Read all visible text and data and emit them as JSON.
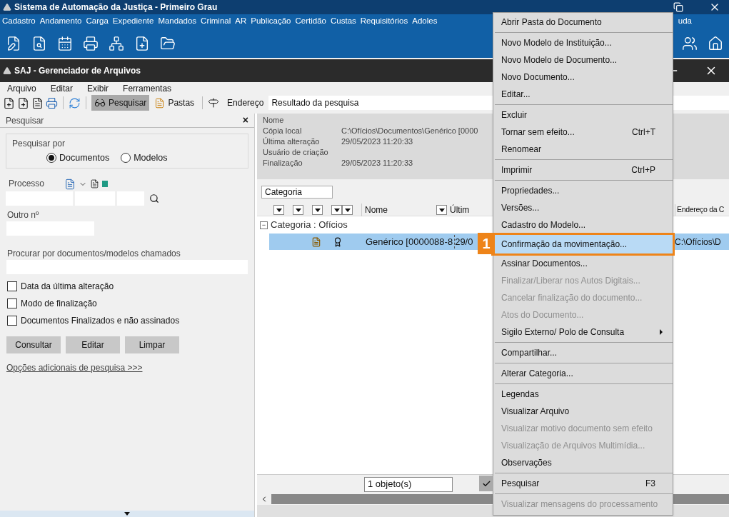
{
  "app": {
    "title": "Sistema de Automação da Justiça - Primeiro Grau",
    "menu": [
      "Cadastro",
      "Andamento",
      "Carga",
      "Expediente",
      "Mandados",
      "Criminal",
      "AR",
      "Publicação",
      "Certidão",
      "Custas",
      "Requisitórios",
      "Adoles"
    ],
    "menu_tail": "uda"
  },
  "window": {
    "title": "SAJ - Gerenciador de Arquivos",
    "menu": [
      "Arquivo",
      "Editar",
      "Exibir",
      "Ferramentas"
    ],
    "toolbar": [
      {
        "label": "Pesquisar",
        "selected": true
      },
      {
        "label": "Pastas",
        "selected": false
      }
    ],
    "address_label": "Endereço",
    "address_value": "Resultado da pesquisa"
  },
  "search_panel": {
    "title": "Pesquisar",
    "close": "×",
    "search_by_label": "Pesquisar por",
    "options": [
      {
        "label": "Documentos",
        "selected": true
      },
      {
        "label": "Modelos",
        "selected": false
      }
    ],
    "processo_label": "Processo",
    "outro_label": "Outro nº",
    "named_label": "Procurar por documentos/modelos chamados",
    "checkboxes": [
      {
        "label": "Data da última alteração",
        "checked": false
      },
      {
        "label": "Modo de finalização",
        "checked": false
      },
      {
        "label": "Documentos Finalizados e não assinados",
        "checked": false
      }
    ],
    "buttons": [
      "Consultar",
      "Editar",
      "Limpar"
    ],
    "link": "Opções adicionais de pesquisa >>>"
  },
  "details": [
    {
      "label": "Nome"
    },
    {
      "label": "Cópia local",
      "value": "C:\\Ofícios\\Documentos\\Genérico [0000"
    },
    {
      "label": "Última alteração",
      "value": "29/05/2023 11:20:33"
    },
    {
      "label": "Usuário de criação"
    },
    {
      "label": "Finalização",
      "value": "29/05/2023 11:20:33"
    }
  ],
  "grid": {
    "group_by": "Categoria",
    "collapse": "−",
    "columns": [
      "Nome",
      "Últim",
      "Endereço da C"
    ],
    "group": "Categoria : Ofícios",
    "rows": [
      {
        "name": "Genérico [0000088-8",
        "date": "29/0",
        "path": "C:\\Ofícios\\D",
        "selected": true
      }
    ],
    "footer": "1 objeto(s)"
  },
  "context_menu": [
    {
      "kind": "item",
      "label": "Abrir Pasta do Documento",
      "disabled": false,
      "selected": false
    },
    {
      "kind": "separator"
    },
    {
      "kind": "item",
      "label": "Novo Modelo de Instituição...",
      "disabled": false,
      "selected": false
    },
    {
      "kind": "item",
      "label": "Novo Modelo de Documento...",
      "disabled": false,
      "selected": false
    },
    {
      "kind": "item",
      "label": "Novo Documento...",
      "disabled": false,
      "selected": false
    },
    {
      "kind": "item",
      "label": "Editar...",
      "disabled": false,
      "selected": false
    },
    {
      "kind": "separator"
    },
    {
      "kind": "item",
      "label": "Excluir",
      "disabled": false,
      "selected": false
    },
    {
      "kind": "item",
      "label": "Tornar sem efeito...",
      "shortcut": "Ctrl+T",
      "disabled": false,
      "selected": false
    },
    {
      "kind": "item",
      "label": "Renomear",
      "disabled": false,
      "selected": false
    },
    {
      "kind": "separator"
    },
    {
      "kind": "item",
      "label": "Imprimir",
      "shortcut": "Ctrl+P",
      "disabled": false,
      "selected": false
    },
    {
      "kind": "separator"
    },
    {
      "kind": "item",
      "label": "Propriedades...",
      "disabled": false,
      "selected": false
    },
    {
      "kind": "item",
      "label": "Versões...",
      "disabled": false,
      "selected": false
    },
    {
      "kind": "item",
      "label": "Cadastro do Modelo...",
      "disabled": false,
      "selected": false
    },
    {
      "kind": "item",
      "label": "Confirmação da movimentação...",
      "disabled": false,
      "selected": true,
      "callout": "1"
    },
    {
      "kind": "item",
      "label": "Assinar Documentos...",
      "disabled": false,
      "selected": false
    },
    {
      "kind": "item",
      "label": "Finalizar/Liberar nos Autos Digitais...",
      "disabled": true,
      "selected": false
    },
    {
      "kind": "item",
      "label": "Cancelar finalização do documento...",
      "disabled": true,
      "selected": false
    },
    {
      "kind": "item",
      "label": "Atos do Documento...",
      "disabled": true,
      "selected": false
    },
    {
      "kind": "item",
      "label": "Sigilo Externo/ Polo de Consulta",
      "submenu": true,
      "disabled": false,
      "selected": false
    },
    {
      "kind": "separator"
    },
    {
      "kind": "item",
      "label": "Compartilhar...",
      "disabled": false,
      "selected": false
    },
    {
      "kind": "separator"
    },
    {
      "kind": "item",
      "label": "Alterar Categoria...",
      "disabled": false,
      "selected": false
    },
    {
      "kind": "separator"
    },
    {
      "kind": "item",
      "label": "Legendas",
      "disabled": false,
      "selected": false
    },
    {
      "kind": "item",
      "label": "Visualizar Arquivo",
      "disabled": false,
      "selected": false
    },
    {
      "kind": "item",
      "label": "Visualizar motivo documento sem efeito",
      "disabled": true,
      "selected": false
    },
    {
      "kind": "item",
      "label": "Visualização de Arquivos Multimídia...",
      "disabled": true,
      "selected": false
    },
    {
      "kind": "item",
      "label": "Observações",
      "disabled": false,
      "selected": false
    },
    {
      "kind": "separator"
    },
    {
      "kind": "item",
      "label": "Pesquisar",
      "shortcut": "F3",
      "checked": true,
      "disabled": false,
      "selected": false
    },
    {
      "kind": "separator"
    },
    {
      "kind": "item",
      "label": "Visualizar mensagens do processamento",
      "disabled": true,
      "selected": false
    }
  ]
}
